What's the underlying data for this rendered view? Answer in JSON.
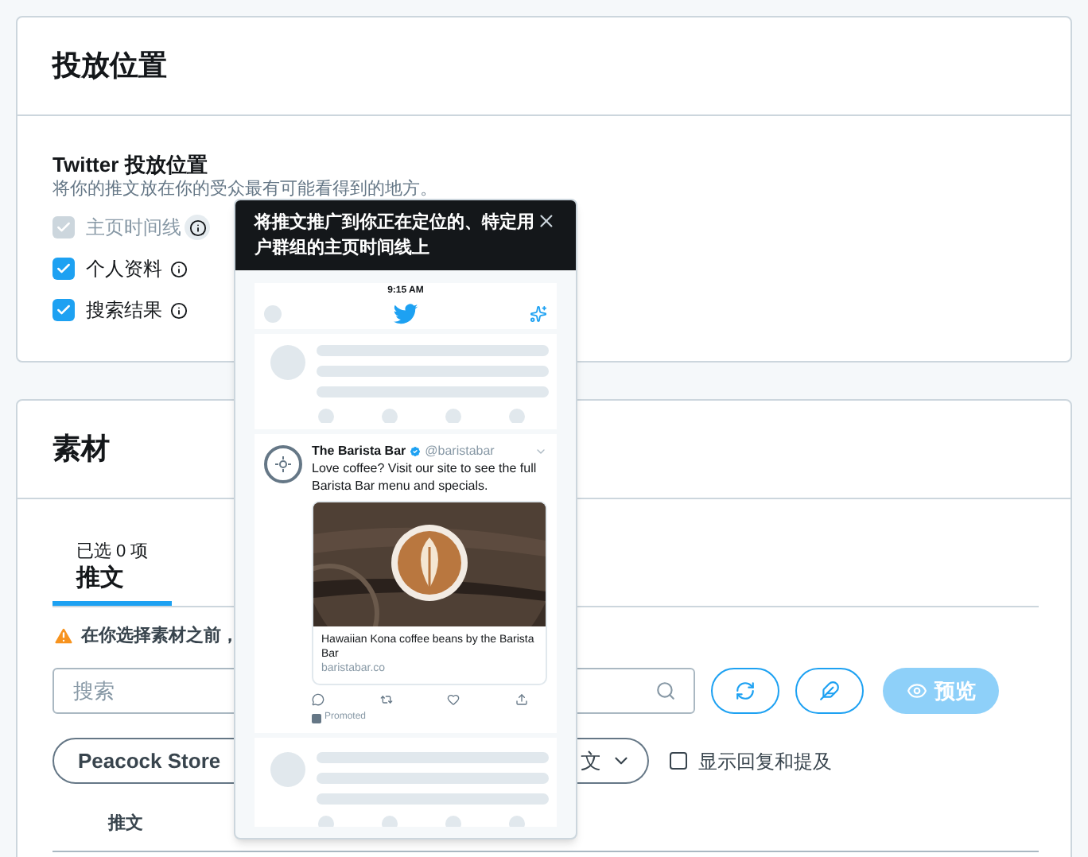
{
  "placement_card": {
    "title": "投放位置",
    "section_title": "Twitter 投放位置",
    "description": "将你的推文放在你的受众最有可能看得到的地方。",
    "options": [
      {
        "label": "主页时间线",
        "checked": true,
        "disabled": true
      },
      {
        "label": "个人资料",
        "checked": true,
        "disabled": false
      },
      {
        "label": "搜索结果",
        "checked": true,
        "disabled": false
      }
    ]
  },
  "popover": {
    "text": "将推文推广到你正在定位的、特定用户群组的主页时间线上",
    "time": "9:15 AM",
    "tweet": {
      "name": "The Barista Bar",
      "handle": "@baristabar",
      "text": "Love coffee? Visit our site to see the full Barista Bar menu and specials.",
      "card_title": "Hawaiian Kona coffee beans by the Barista Bar",
      "card_domain": "baristabar.co",
      "promoted": "Promoted"
    }
  },
  "creative_card": {
    "title": "素材",
    "tabs": [
      {
        "count": "已选 0 项",
        "label": "推文",
        "selected": true
      }
    ],
    "warning": "在你选择素材之前，",
    "search": {
      "placeholder": "搜索"
    },
    "preview_button": {
      "label": "预览",
      "disabled": true
    },
    "account_button": "Peacock Store",
    "type_button": "文",
    "show_replies": {
      "label": "显示回复和提及",
      "checked": false
    },
    "table": {
      "columns": [
        "推文"
      ]
    }
  }
}
